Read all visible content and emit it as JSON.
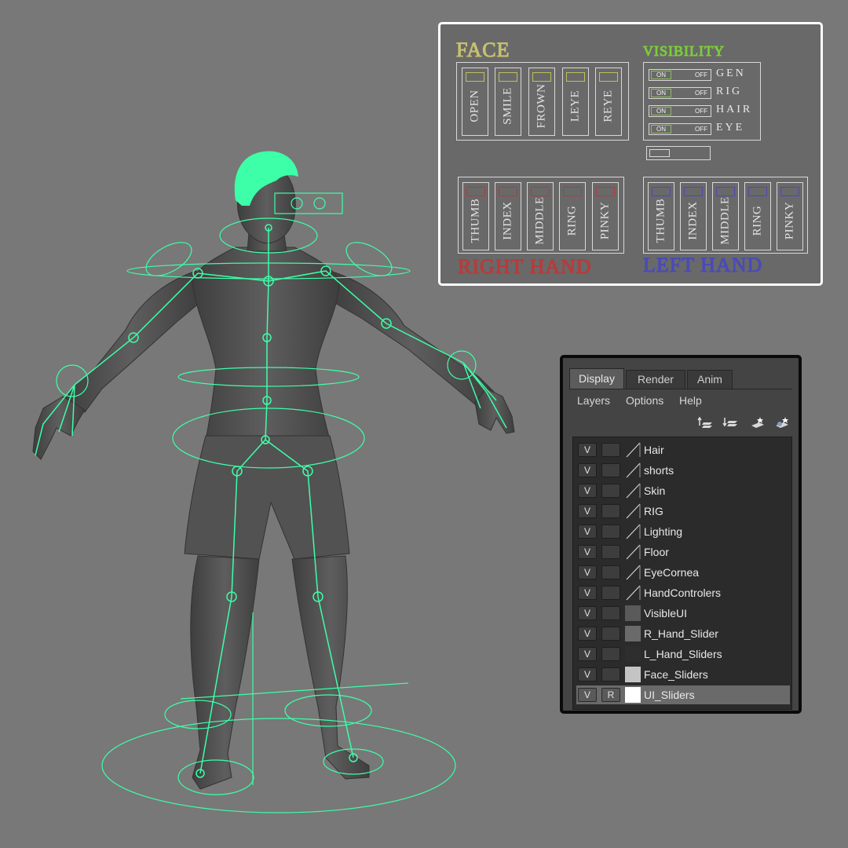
{
  "colors": {
    "background": "#787878",
    "rig": "#3dffa8",
    "face": "#c8c070",
    "visibility": "#7ccc3a",
    "right_hand": "#b83a3a",
    "left_hand": "#4a4ab8"
  },
  "rig_panel": {
    "face": {
      "title": "FACE",
      "sliders": [
        "OPEN",
        "SMILE",
        "FROWN",
        "LEYE",
        "REYE"
      ]
    },
    "visibility": {
      "title": "VISIBILITY",
      "on_label": "ON",
      "off_label": "OFF",
      "rows": [
        "GEN",
        "RIG",
        "HAIR",
        "EYE"
      ]
    },
    "right_hand": {
      "title": "RIGHT HAND",
      "sliders": [
        "THUMB",
        "INDEX",
        "MIDDLE",
        "RING",
        "PINKY"
      ]
    },
    "left_hand": {
      "title": "LEFT HAND",
      "sliders": [
        "THUMB",
        "INDEX",
        "MIDDLE",
        "RING",
        "PINKY"
      ]
    }
  },
  "layer_editor": {
    "tabs": [
      "Display",
      "Render",
      "Anim"
    ],
    "menu": [
      "Layers",
      "Options",
      "Help"
    ],
    "tool_icons": [
      "move-layer-up-icon",
      "move-layer-down-icon",
      "create-empty-layer-icon",
      "create-layer-from-selected-icon"
    ],
    "layers": [
      {
        "v": "V",
        "r": "",
        "swatch": "slash",
        "name": "Hair"
      },
      {
        "v": "V",
        "r": "",
        "swatch": "slash",
        "name": "shorts"
      },
      {
        "v": "V",
        "r": "",
        "swatch": "slash",
        "name": "Skin"
      },
      {
        "v": "V",
        "r": "",
        "swatch": "slash",
        "name": "RIG"
      },
      {
        "v": "V",
        "r": "",
        "swatch": "slash",
        "name": "Lighting"
      },
      {
        "v": "V",
        "r": "",
        "swatch": "slash",
        "name": "Floor"
      },
      {
        "v": "V",
        "r": "",
        "swatch": "slash",
        "name": "EyeCornea"
      },
      {
        "v": "V",
        "r": "",
        "swatch": "slash",
        "name": "HandControlers"
      },
      {
        "v": "V",
        "r": "",
        "swatch": "#5a5a5a",
        "name": "VisibleUI"
      },
      {
        "v": "V",
        "r": "",
        "swatch": "#6a6a6a",
        "name": "R_Hand_Slider"
      },
      {
        "v": "V",
        "r": "",
        "swatch": "#2e2e2e",
        "name": "L_Hand_Sliders"
      },
      {
        "v": "V",
        "r": "",
        "swatch": "#c4c4c4",
        "name": "Face_Sliders"
      },
      {
        "v": "V",
        "r": "R",
        "swatch": "#ffffff",
        "name": "UI_Sliders",
        "selected": true
      }
    ]
  }
}
